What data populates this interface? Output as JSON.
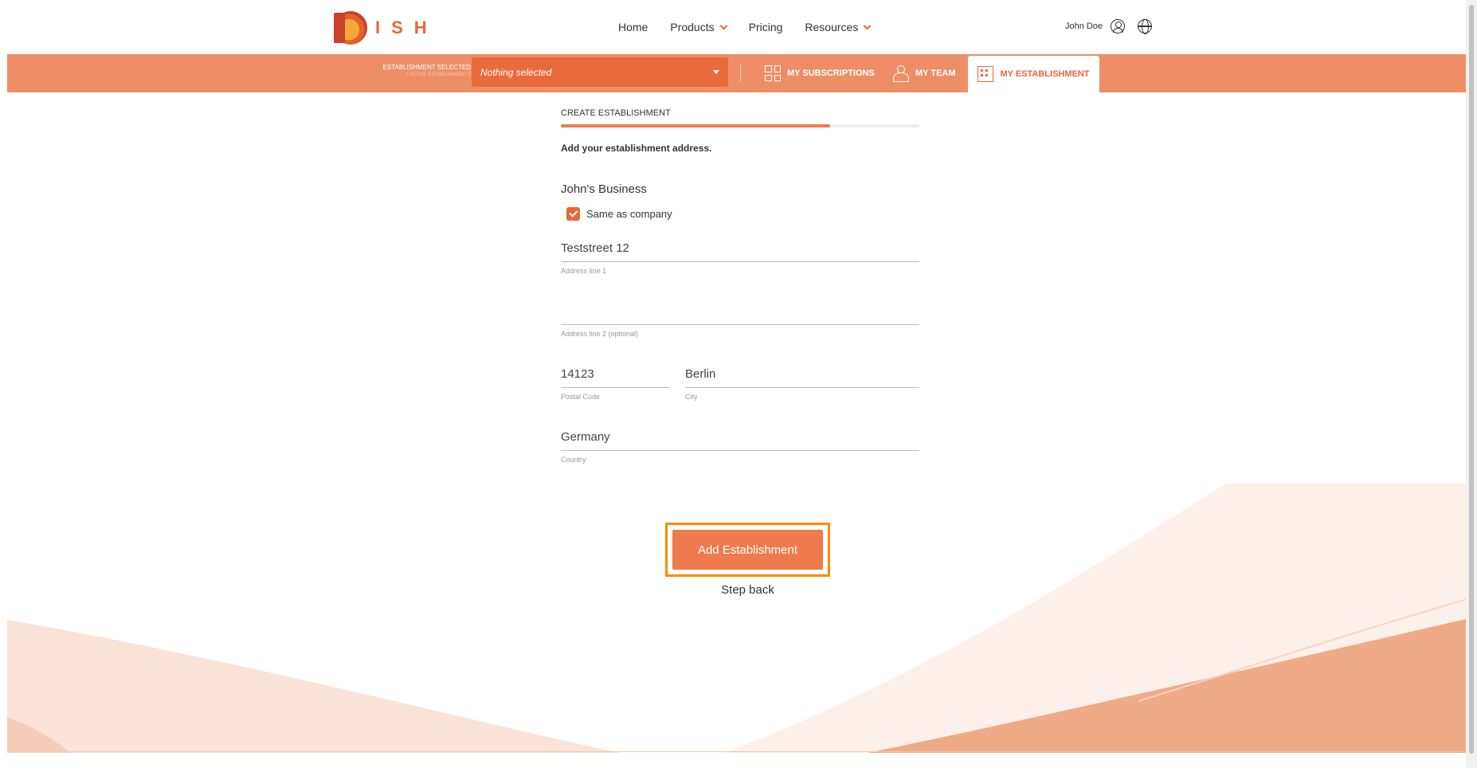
{
  "header": {
    "logo_text": "ISH",
    "nav": [
      {
        "label": "Home",
        "has_dropdown": false
      },
      {
        "label": "Products",
        "has_dropdown": true
      },
      {
        "label": "Pricing",
        "has_dropdown": false
      },
      {
        "label": "Resources",
        "has_dropdown": true
      }
    ],
    "user_name": "John Doe"
  },
  "establishment_bar": {
    "label": "ESTABLISHMENT SELECTED",
    "sublabel": "0 ACTIVE ESTABLISHMENTS",
    "select_value": "Nothing selected",
    "tabs": [
      {
        "label": "MY SUBSCRIPTIONS",
        "icon": "grid-icon"
      },
      {
        "label": "MY TEAM",
        "icon": "team-icon"
      },
      {
        "label": "MY ESTABLISHMENT",
        "icon": "building-icon",
        "active": true
      }
    ]
  },
  "form": {
    "step_title": "CREATE ESTABLISHMENT",
    "progress_fraction": 0.75,
    "instruction": "Add your establishment address.",
    "company_name": "John's Business",
    "same_as_company_label": "Same as company",
    "same_as_company_checked": true,
    "address_line1_value": "Teststreet 12",
    "address_line1_label": "Address line 1",
    "address_line2_value": "",
    "address_line2_label": "Address line 2 (optional)",
    "postal_code_value": "14123",
    "postal_code_label": "Postal Code",
    "city_value": "Berlin",
    "city_label": "City",
    "country_value": "Germany",
    "country_label": "Country",
    "submit_label": "Add Establishment",
    "back_label": "Step back"
  },
  "colors": {
    "accent": "#e8673a",
    "bar": "#ee8e66",
    "highlight": "#ff8a00"
  }
}
